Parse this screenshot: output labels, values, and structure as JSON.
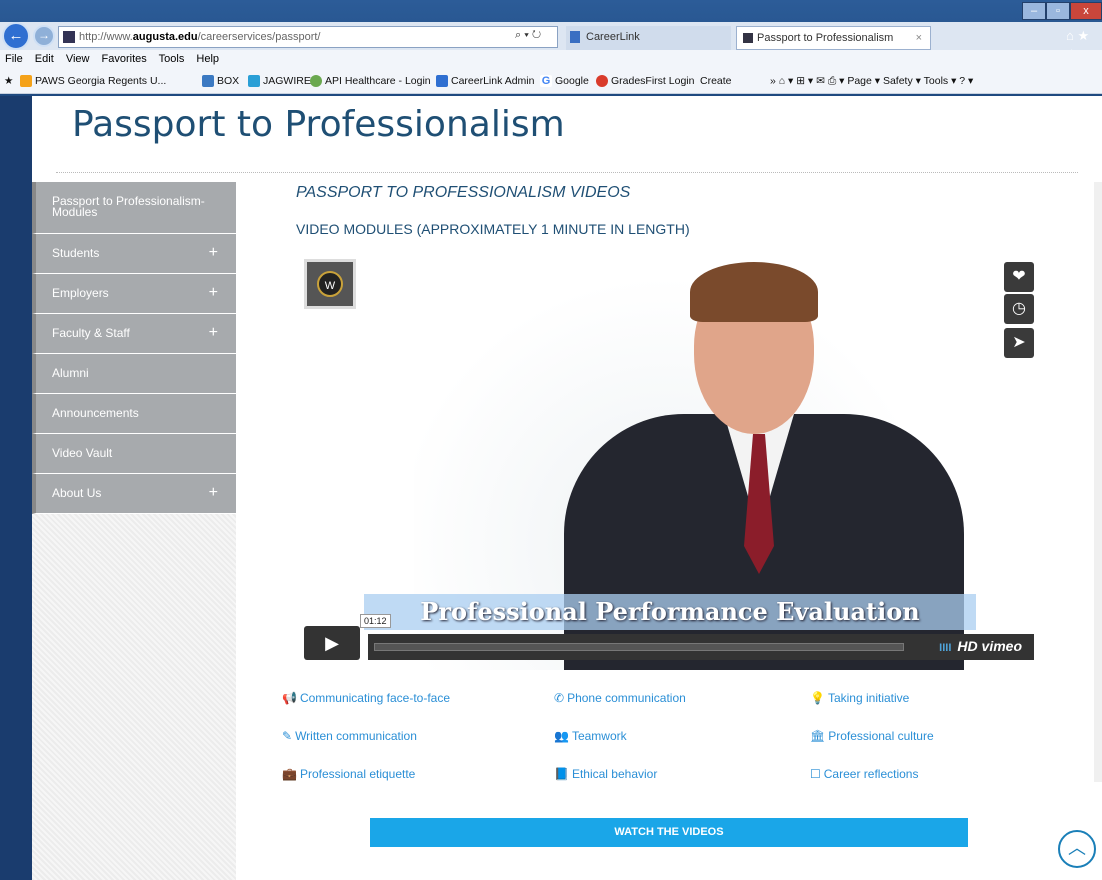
{
  "browser": {
    "url_prefix": "http://www.",
    "url_domain": "augusta.edu",
    "url_path": "/careerservices/passport/",
    "addr_controls": "⌕ ▾ ↻",
    "tab1_label": "CareerLink",
    "tab2_label": "Passport to Professionalism",
    "tab2_close": "×",
    "win_min": "–",
    "win_max": "▫",
    "win_close": "x",
    "toolbar_icons": "⌂ ★ ☼",
    "menu": [
      "File",
      "Edit",
      "View",
      "Favorites",
      "Tools",
      "Help"
    ],
    "favorites": [
      "PAWS Georgia Regents U...",
      "BOX",
      "JAGWIRE",
      "API Healthcare - Login",
      "CareerLink Admin",
      "Google",
      "GradesFirst Login",
      "Create"
    ],
    "right_tools": "» ⌂ ▾ ⊞ ▾ ✉ ⎙ ▾ Page ▾  Safety ▾  Tools ▾ ? ▾"
  },
  "page": {
    "title": "Passport to Professionalism",
    "heading": "PASSPORT TO PROFESSIONALISM VIDEOS",
    "subheading": "VIDEO MODULES (APPROXIMATELY 1 MINUTE IN LENGTH)"
  },
  "sidebar": {
    "items": [
      {
        "label": "Passport to Professionalism-Modules",
        "plus": ""
      },
      {
        "label": "Students",
        "plus": "+"
      },
      {
        "label": "Employers",
        "plus": "+"
      },
      {
        "label": "Faculty & Staff",
        "plus": "+"
      },
      {
        "label": "Alumni",
        "plus": ""
      },
      {
        "label": "Announcements",
        "plus": ""
      },
      {
        "label": "Video Vault",
        "plus": ""
      },
      {
        "label": "About Us",
        "plus": "+"
      }
    ]
  },
  "video": {
    "logo_letter": "W",
    "overlay_title": "Professional Performance Evaluation",
    "time": "01:12",
    "play_icon": "▶",
    "hd_label": "HD",
    "brand": "vimeo",
    "bars": "IIII",
    "side_icons": [
      "❤",
      "◷",
      "➤"
    ]
  },
  "links": [
    {
      "label": "Communicating face-to-face",
      "icon": "📢"
    },
    {
      "label": "Phone communication",
      "icon": "✆"
    },
    {
      "label": "Taking initiative",
      "icon": "💡"
    },
    {
      "label": "Written communication",
      "icon": "✎"
    },
    {
      "label": "Teamwork",
      "icon": "👥"
    },
    {
      "label": "Professional culture",
      "icon": "🏛"
    },
    {
      "label": "Professional etiquette",
      "icon": "💼"
    },
    {
      "label": "Ethical behavior",
      "icon": "📘"
    },
    {
      "label": "Career reflections",
      "icon": "☐"
    }
  ],
  "cta": {
    "label": "WATCH THE VIDEOS"
  },
  "back_to_top": "︿",
  "colors": {
    "accent": "#1aa6e8",
    "title": "#1f4f74",
    "link": "#2b8fd6",
    "sidebar": "#a7aaad"
  }
}
